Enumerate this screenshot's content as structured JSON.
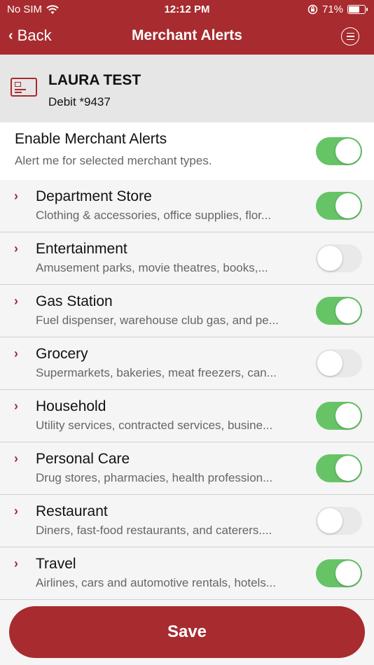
{
  "status_bar": {
    "carrier": "No SIM",
    "time": "12:12 PM",
    "battery_pct": "71%",
    "battery_level": 0.71
  },
  "nav": {
    "back_label": "Back",
    "title": "Merchant Alerts"
  },
  "account": {
    "name": "LAURA TEST",
    "subtitle": "Debit *9437"
  },
  "enable": {
    "title": "Enable Merchant Alerts",
    "description": "Alert me for selected merchant types.",
    "enabled": true
  },
  "categories": [
    {
      "name": "Department Store",
      "description": "Clothing & accessories, office supplies, flor...",
      "enabled": true
    },
    {
      "name": "Entertainment",
      "description": "Amusement parks, movie theatres, books,...",
      "enabled": false
    },
    {
      "name": "Gas Station",
      "description": "Fuel dispenser, warehouse club gas, and pe...",
      "enabled": true
    },
    {
      "name": "Grocery",
      "description": "Supermarkets, bakeries, meat freezers, can...",
      "enabled": false
    },
    {
      "name": "Household",
      "description": "Utility services, contracted services, busine...",
      "enabled": true
    },
    {
      "name": "Personal Care",
      "description": "Drug stores, pharmacies, health profession...",
      "enabled": true
    },
    {
      "name": "Restaurant",
      "description": "Diners, fast-food restaurants, and caterers....",
      "enabled": false
    },
    {
      "name": "Travel",
      "description": "Airlines, cars and automotive rentals, hotels...",
      "enabled": true
    }
  ],
  "save_label": "Save",
  "colors": {
    "brand": "#a72b2f",
    "toggle_on": "#66c466",
    "toggle_off": "#e9e9e9"
  }
}
